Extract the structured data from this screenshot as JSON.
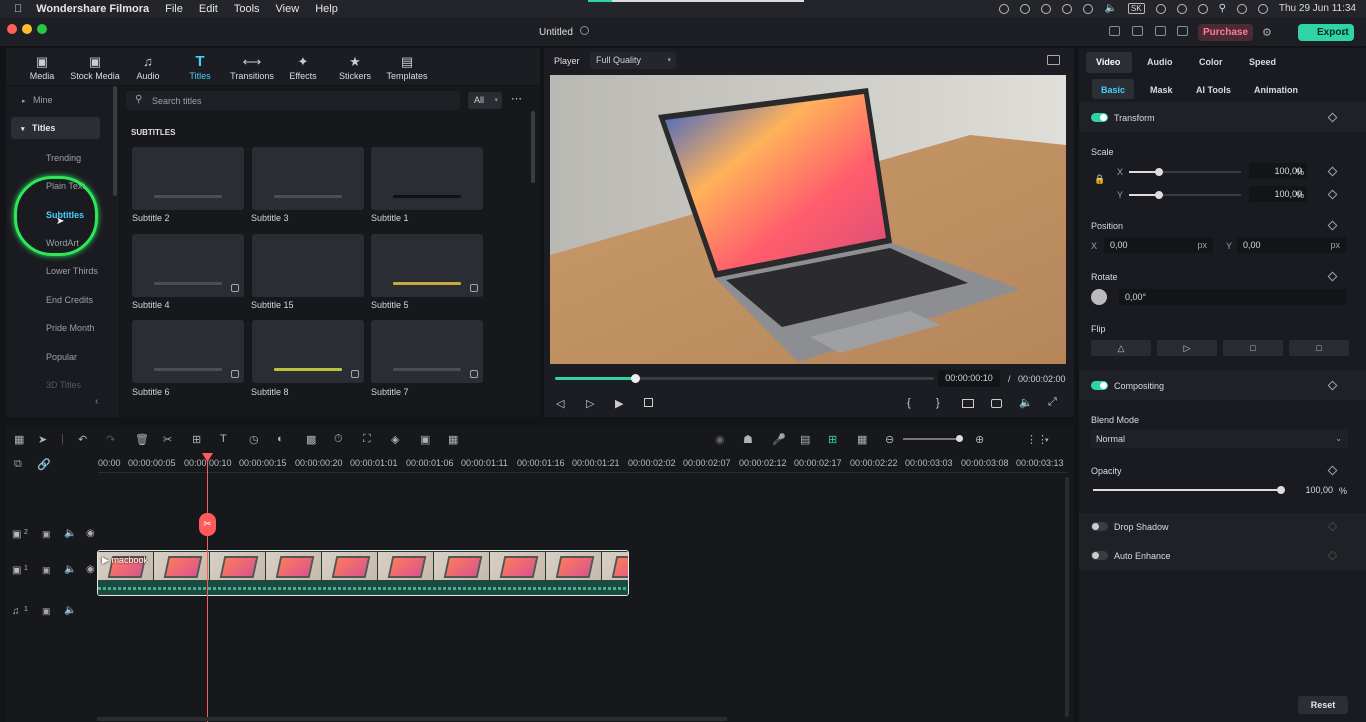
{
  "menubar": {
    "app_name": "Wondershare Filmora",
    "menus": [
      "File",
      "Edit",
      "Tools",
      "View",
      "Help"
    ],
    "datetime": "Thu 29 Jun  11:34",
    "keyboard": "SK"
  },
  "titlebar": {
    "project_title": "Untitled",
    "purchase_label": "Purchase",
    "export_label": "Export"
  },
  "library": {
    "tabs": [
      {
        "label": "Media",
        "icon": "media-icon"
      },
      {
        "label": "Stock Media",
        "icon": "stock-media-icon"
      },
      {
        "label": "Audio",
        "icon": "audio-icon"
      },
      {
        "label": "Titles",
        "icon": "titles-icon"
      },
      {
        "label": "Transitions",
        "icon": "transitions-icon"
      },
      {
        "label": "Effects",
        "icon": "effects-icon"
      },
      {
        "label": "Stickers",
        "icon": "stickers-icon"
      },
      {
        "label": "Templates",
        "icon": "templates-icon"
      }
    ],
    "sidebar": {
      "mine": "Mine",
      "titles": "Titles",
      "items": [
        "Trending",
        "Plain Text",
        "Subtitles",
        "WordArt",
        "Lower Thirds",
        "End Credits",
        "Pride Month",
        "Popular",
        "3D Titles"
      ],
      "selected": "Subtitles"
    },
    "search_placeholder": "Search titles",
    "filter": "All",
    "section": "SUBTITLES",
    "thumbnails": [
      {
        "name": "Subtitle 2"
      },
      {
        "name": "Subtitle 3"
      },
      {
        "name": "Subtitle 1"
      },
      {
        "name": "Subtitle 4"
      },
      {
        "name": "Subtitle 15"
      },
      {
        "name": "Subtitle 5"
      },
      {
        "name": "Subtitle 6"
      },
      {
        "name": "Subtitle 8"
      },
      {
        "name": "Subtitle 7"
      }
    ]
  },
  "player": {
    "label": "Player",
    "quality": "Full Quality",
    "current_time": "00:00:00:10",
    "separator": "/",
    "total_time": "00:00:02:00",
    "progress": 0.21
  },
  "timeline": {
    "ruler": [
      "00:00",
      "00:00:00:05",
      "00:00:00:10",
      "00:00:00:15",
      "00:00:00:20",
      "00:00:01:01",
      "00:00:01:06",
      "00:00:01:11",
      "00:00:01:16",
      "00:00:01:21",
      "00:00:02:02",
      "00:00:02:07",
      "00:00:02:12",
      "00:00:02:17",
      "00:00:02:22",
      "00:00:03:03",
      "00:00:03:08",
      "00:00:03:13"
    ],
    "tracks": [
      {
        "num": "2"
      },
      {
        "num": "1"
      },
      {
        "num": "1"
      }
    ],
    "clip_name": "macbook"
  },
  "properties": {
    "tabs": [
      "Video",
      "Audio",
      "Color",
      "Speed"
    ],
    "subtabs": [
      "Basic",
      "Mask",
      "AI Tools",
      "Animation"
    ],
    "transform": "Transform",
    "scale": "Scale",
    "scale_x_label": "X",
    "scale_y_label": "Y",
    "scale_x": "100,00",
    "scale_y": "100,00",
    "percent": "%",
    "position": "Position",
    "pos_x_label": "X",
    "pos_y_label": "Y",
    "pos_x": "0,00",
    "pos_y": "0,00",
    "px": "px",
    "rotate": "Rotate",
    "rotate_value": "0,00°",
    "flip": "Flip",
    "compositing": "Compositing",
    "blend_mode_label": "Blend Mode",
    "blend_mode": "Normal",
    "opacity_label": "Opacity",
    "opacity_value": "100,00",
    "drop_shadow": "Drop Shadow",
    "auto_enhance": "Auto Enhance",
    "reset": "Reset"
  },
  "colors": {
    "accent": "#45d0ff",
    "export": "#2fd4a6",
    "playhead": "#ff5a5a",
    "highlight_circle": "#2ee65a"
  }
}
